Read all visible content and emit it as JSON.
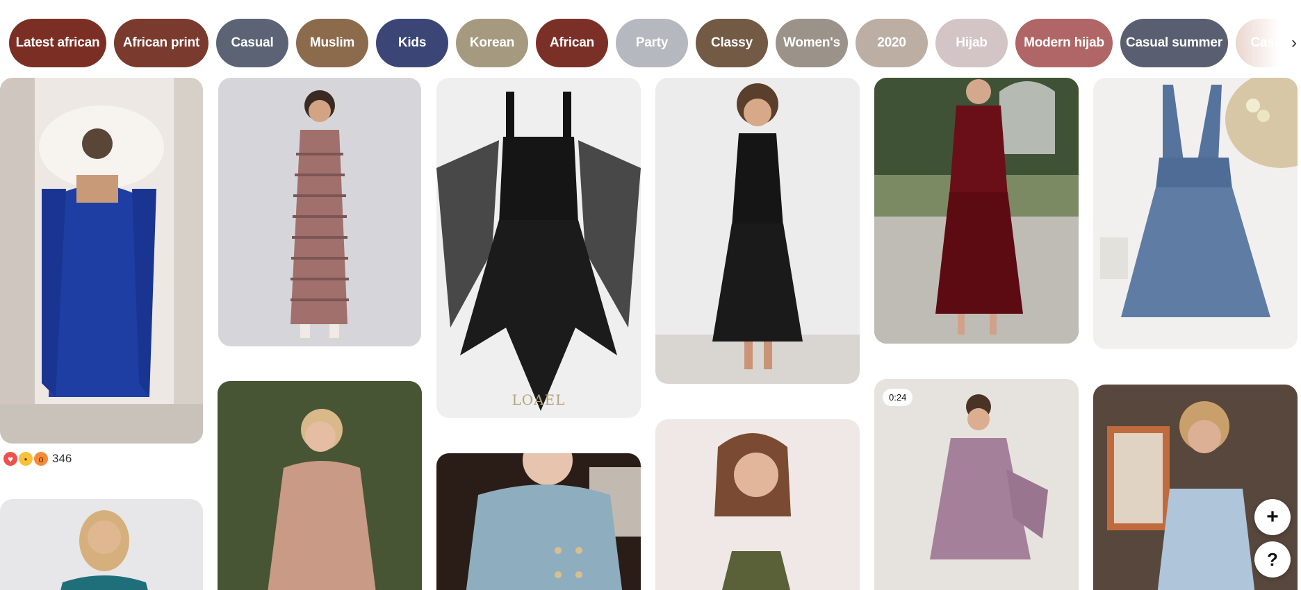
{
  "chips": [
    {
      "label": "Latest african",
      "color": "#7b2f24"
    },
    {
      "label": "African print",
      "color": "#7b3a2e"
    },
    {
      "label": "Casual",
      "color": "#5b6375"
    },
    {
      "label": "Muslim",
      "color": "#8b6b4c"
    },
    {
      "label": "Kids",
      "color": "#3b4677"
    },
    {
      "label": "Korean",
      "color": "#a59a80"
    },
    {
      "label": "African",
      "color": "#7b3027"
    },
    {
      "label": "Party",
      "color": "#b5b8be"
    },
    {
      "label": "Classy",
      "color": "#735a45"
    },
    {
      "label": "Women's",
      "color": "#9b928a"
    },
    {
      "label": "2020",
      "color": "#bcaea3"
    },
    {
      "label": "Hijab",
      "color": "#d3c4c5"
    },
    {
      "label": "Modern hijab",
      "color": "#b06666"
    },
    {
      "label": "Casual summer",
      "color": "#595f70"
    },
    {
      "label": "Casual",
      "color": "#e7cfc5"
    }
  ],
  "chips_next_icon": "chevron-right-icon",
  "pins": {
    "video_duration": "0:24",
    "brand_watermark": "LOAEL",
    "reactions": {
      "icons": [
        "heart-icon",
        "wow-icon",
        "surprised-icon"
      ],
      "count": "346"
    }
  },
  "fabs": {
    "add_label": "+",
    "help_label": "?"
  }
}
